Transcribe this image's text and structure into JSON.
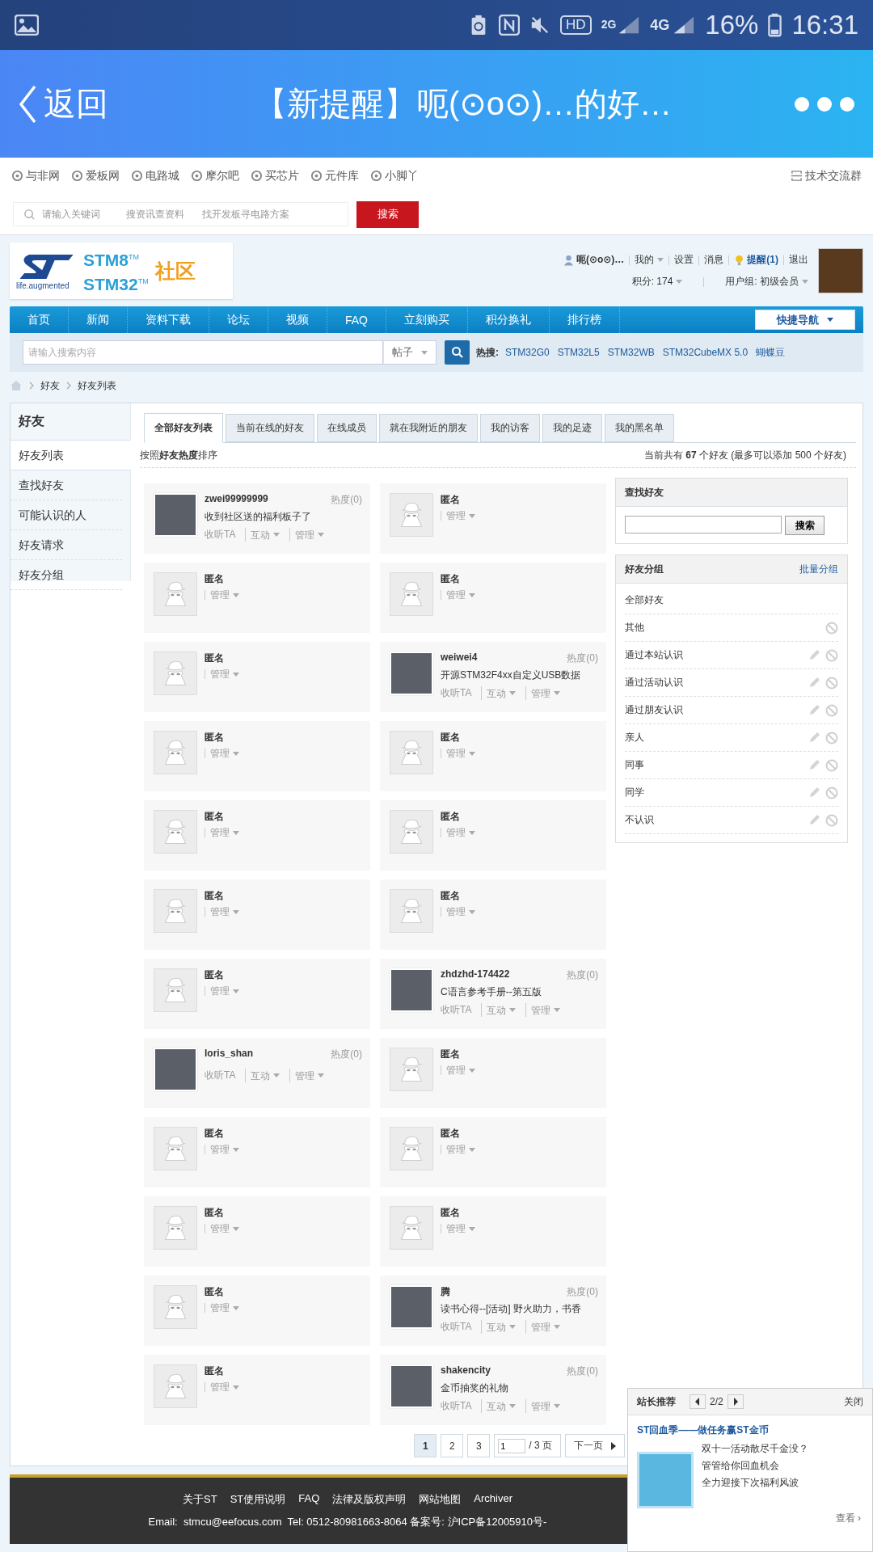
{
  "status_bar": {
    "hd": "HD",
    "network_1": "2G",
    "network_2": "4G",
    "battery": "16%",
    "time": "16:31"
  },
  "title_bar": {
    "back": "返回",
    "title": "【新提醒】呃(⊙o⊙)…的好…"
  },
  "site_links": {
    "items": [
      "与非网",
      "爱板网",
      "电路城",
      "摩尔吧",
      "买芯片",
      "元件库",
      "小脚丫"
    ],
    "right": "技术交流群"
  },
  "site_search": {
    "placeholder": "请输入关键词",
    "hints": [
      "搜资讯查资料",
      "找开发板寻电路方案"
    ],
    "button": "搜索"
  },
  "logo": {
    "tagline": "life.augmented",
    "lines": [
      "STM8$^{TM}$",
      "STM32$^{TM}$"
    ],
    "community": "社区"
  },
  "user": {
    "name": "呃(⊙o⊙)…",
    "menu": "我的",
    "settings": "设置",
    "messages": "消息",
    "alerts": "提醒(1)",
    "logout": "退出",
    "points": "积分: 174",
    "group": "用户组: 初级会员"
  },
  "nav": {
    "items": [
      "首页",
      "新闻",
      "资料下载",
      "论坛",
      "视频",
      "FAQ",
      "立刻购买",
      "积分换礼",
      "排行榜"
    ],
    "quick": "快捷导航"
  },
  "forum_search": {
    "placeholder": "请输入搜索内容",
    "scope": "帖子",
    "hot_label": "热搜:",
    "hot": [
      "STM32G0",
      "STM32L5",
      "STM32WB",
      "STM32CubeMX 5.0",
      "蝴蝶豆"
    ]
  },
  "breadcrumb": [
    "好友",
    "好友列表"
  ],
  "sidebar": {
    "title": "好友",
    "items": [
      {
        "label": "好友列表",
        "selected": true
      },
      {
        "label": "查找好友",
        "selected": false
      },
      {
        "label": "可能认识的人",
        "selected": false
      },
      {
        "label": "好友请求",
        "selected": false
      },
      {
        "label": "好友分组",
        "selected": false
      }
    ]
  },
  "tabs": [
    {
      "label": "全部好友列表",
      "selected": true
    },
    {
      "label": "当前在线的好友",
      "selected": false
    },
    {
      "label": "在线成员",
      "selected": false
    },
    {
      "label": "就在我附近的朋友",
      "selected": false
    },
    {
      "label": "我的访客",
      "selected": false
    },
    {
      "label": "我的足迹",
      "selected": false
    },
    {
      "label": "我的黑名单",
      "selected": false
    }
  ],
  "sort_note": "按照**好友热度**排序",
  "count_note": "当前共有 **67** 个好友 (最多可以添加 500 个好友)",
  "friends": [
    {
      "kind": "friend",
      "name": "zwei99999999",
      "heat": "热度(0)",
      "status": "收到社区送的福利板子了",
      "actions": [
        "收听TA",
        "互动",
        "管理"
      ]
    },
    {
      "kind": "anonymous",
      "name": "匿名",
      "actions": [
        "管理"
      ]
    },
    {
      "kind": "anonymous",
      "name": "匿名",
      "actions": [
        "管理"
      ]
    },
    {
      "kind": "anonymous",
      "name": "匿名",
      "actions": [
        "管理"
      ]
    },
    {
      "kind": "anonymous",
      "name": "匿名",
      "actions": [
        "管理"
      ]
    },
    {
      "kind": "friend",
      "name": "weiwei4",
      "heat": "热度(0)",
      "status": "开源STM32F4xx自定义USB数据",
      "actions": [
        "收听TA",
        "互动",
        "管理"
      ]
    },
    {
      "kind": "anonymous",
      "name": "匿名",
      "actions": [
        "管理"
      ]
    },
    {
      "kind": "anonymous",
      "name": "匿名",
      "actions": [
        "管理"
      ]
    },
    {
      "kind": "anonymous",
      "name": "匿名",
      "actions": [
        "管理"
      ]
    },
    {
      "kind": "anonymous",
      "name": "匿名",
      "actions": [
        "管理"
      ]
    },
    {
      "kind": "anonymous",
      "name": "匿名",
      "actions": [
        "管理"
      ]
    },
    {
      "kind": "anonymous",
      "name": "匿名",
      "actions": [
        "管理"
      ]
    },
    {
      "kind": "anonymous",
      "name": "匿名",
      "actions": [
        "管理"
      ]
    },
    {
      "kind": "friend",
      "name": "zhdzhd-174422",
      "heat": "热度(0)",
      "status": "C语言参考手册--第五版",
      "actions": [
        "收听TA",
        "互动",
        "管理"
      ]
    },
    {
      "kind": "friend",
      "name": "loris_shan",
      "heat": "热度(0)",
      "actions": [
        "收听TA",
        "互动",
        "管理"
      ]
    },
    {
      "kind": "anonymous",
      "name": "匿名",
      "actions": [
        "管理"
      ]
    },
    {
      "kind": "anonymous",
      "name": "匿名",
      "actions": [
        "管理"
      ]
    },
    {
      "kind": "anonymous",
      "name": "匿名",
      "actions": [
        "管理"
      ]
    },
    {
      "kind": "anonymous",
      "name": "匿名",
      "actions": [
        "管理"
      ]
    },
    {
      "kind": "anonymous",
      "name": "匿名",
      "actions": [
        "管理"
      ]
    },
    {
      "kind": "anonymous",
      "name": "匿名",
      "actions": [
        "管理"
      ]
    },
    {
      "kind": "friend",
      "name": "腾",
      "heat": "热度(0)",
      "status": "读书心得--[活动] 野火助力，书香",
      "actions": [
        "收听TA",
        "互动",
        "管理"
      ]
    },
    {
      "kind": "anonymous",
      "name": "匿名",
      "actions": [
        "管理"
      ]
    },
    {
      "kind": "friend",
      "name": "shakencity",
      "heat": "热度(0)",
      "status": "金币抽奖的礼物",
      "actions": [
        "收听TA",
        "互动",
        "管理"
      ]
    }
  ],
  "pagination": {
    "pages": [
      {
        "label": "1",
        "selected": true
      },
      {
        "label": "2",
        "selected": false
      },
      {
        "label": "3",
        "selected": false
      }
    ],
    "input": "1",
    "total": "/ 3 页",
    "next": "下一页"
  },
  "find_friend": {
    "title": "查找好友",
    "button": "搜索"
  },
  "groups": {
    "title": "好友分组",
    "action": "批量分组",
    "items": [
      {
        "label": "全部好友",
        "editable": false,
        "deletable": false
      },
      {
        "label": "其他",
        "editable": false,
        "deletable": true
      },
      {
        "label": "通过本站认识",
        "editable": true,
        "deletable": true
      },
      {
        "label": "通过活动认识",
        "editable": true,
        "deletable": true
      },
      {
        "label": "通过朋友认识",
        "editable": true,
        "deletable": true
      },
      {
        "label": "亲人",
        "editable": true,
        "deletable": true
      },
      {
        "label": "同事",
        "editable": true,
        "deletable": true
      },
      {
        "label": "同学",
        "editable": true,
        "deletable": true
      },
      {
        "label": "不认识",
        "editable": true,
        "deletable": true
      }
    ]
  },
  "footer": {
    "links": [
      "关于ST",
      "ST使用说明",
      "FAQ",
      "法律及版权声明",
      "网站地图",
      "Archiver"
    ],
    "contact": "Email:  stmcu@eefocus.com  Tel: 0512-80981663-8064 备案号: 沪ICP备12005910号-"
  },
  "popup": {
    "title": "站长推荐",
    "page": "2/2",
    "close": "关闭",
    "headline": "ST回血季——做任务赢ST金币",
    "lines": [
      "双十一活动散尽千金没？",
      "管管给你回血机会",
      "全力迎接下次福利风波"
    ],
    "more": "查看 ›"
  }
}
